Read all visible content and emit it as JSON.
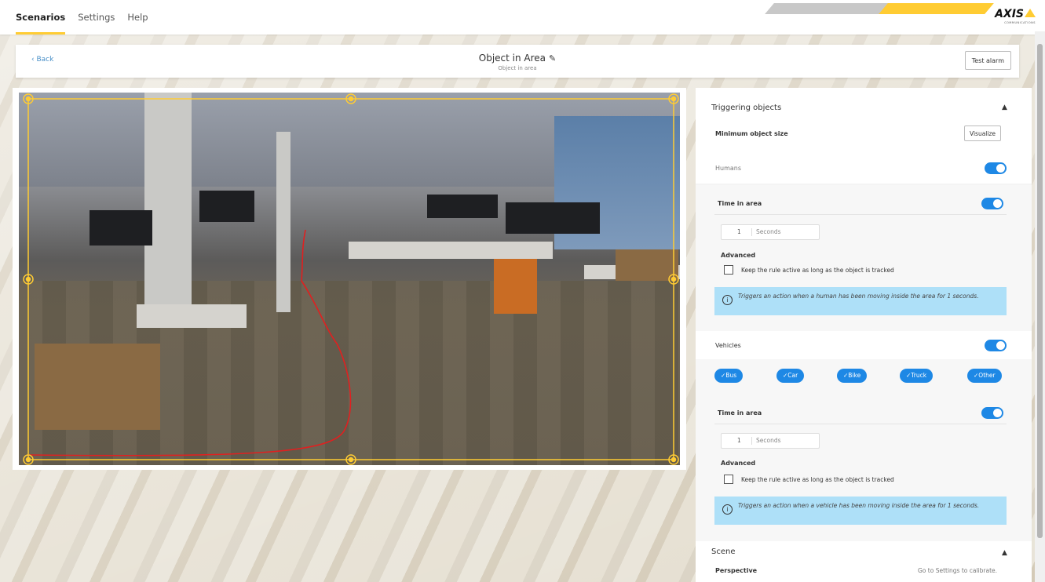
{
  "nav": {
    "tabs": [
      {
        "label": "Scenarios",
        "active": true
      },
      {
        "label": "Settings",
        "active": false
      },
      {
        "label": "Help",
        "active": false
      }
    ],
    "logo": "AXIS",
    "logo_sub": "COMMUNICATIONS"
  },
  "header": {
    "back_label": "‹ Back",
    "title": "Object in Area",
    "subtitle": "Object in area",
    "test_alarm_label": "Test alarm"
  },
  "panel": {
    "triggering_objects": {
      "title": "Triggering objects",
      "min_size_label": "Minimum object size",
      "visualize_label": "Visualize",
      "humans": {
        "label": "Humans",
        "enabled": true,
        "time_in_area_label": "Time in area",
        "time_in_area_enabled": true,
        "time_value": "1",
        "time_unit": "Seconds",
        "advanced_label": "Advanced",
        "keep_active_label": "Keep the rule active as long as the object is tracked",
        "info": "Triggers an action when a human has been moving inside the area for 1 seconds."
      },
      "vehicles": {
        "label": "Vehicles",
        "enabled": true,
        "chips": [
          "Bus",
          "Car",
          "Bike",
          "Truck",
          "Other"
        ],
        "time_in_area_label": "Time in area",
        "time_in_area_enabled": true,
        "time_value": "1",
        "time_unit": "Seconds",
        "advanced_label": "Advanced",
        "keep_active_label": "Keep the rule active as long as the object is tracked",
        "info": "Triggers an action when a vehicle has been moving inside the area for 1 seconds."
      }
    },
    "scene": {
      "title": "Scene",
      "perspective_label": "Perspective",
      "perspective_hint": "Go to Settings to calibrate."
    }
  },
  "colors": {
    "accent": "#ffcc33",
    "toggle": "#1e88e5",
    "info_bg": "#aee0f8",
    "link": "#4a90c8",
    "path": "#e02020"
  }
}
